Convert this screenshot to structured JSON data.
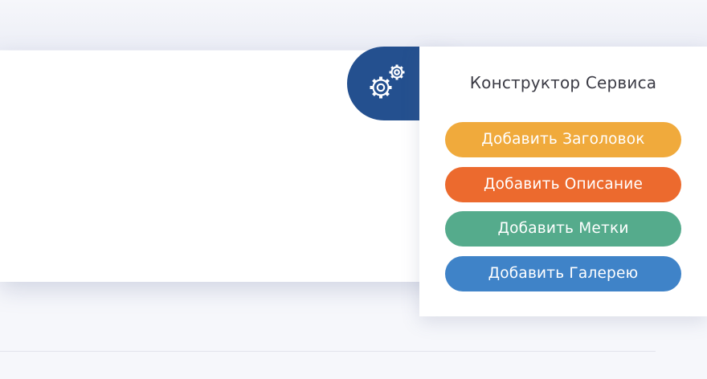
{
  "panel": {
    "title": "Конструктор Сервиса",
    "toggle_icon": "gears-icon",
    "buttons": [
      {
        "label": "Добавить Заголовок",
        "color": "#f0aa3c"
      },
      {
        "label": "Добавить Описание",
        "color": "#ec6a2e"
      },
      {
        "label": "Добавить Метки",
        "color": "#55ab8c"
      },
      {
        "label": "Добавить Галерею",
        "color": "#3f83c8"
      }
    ]
  },
  "colors": {
    "toggle_background": "#24508f",
    "page_background": "#f6f7fb"
  }
}
